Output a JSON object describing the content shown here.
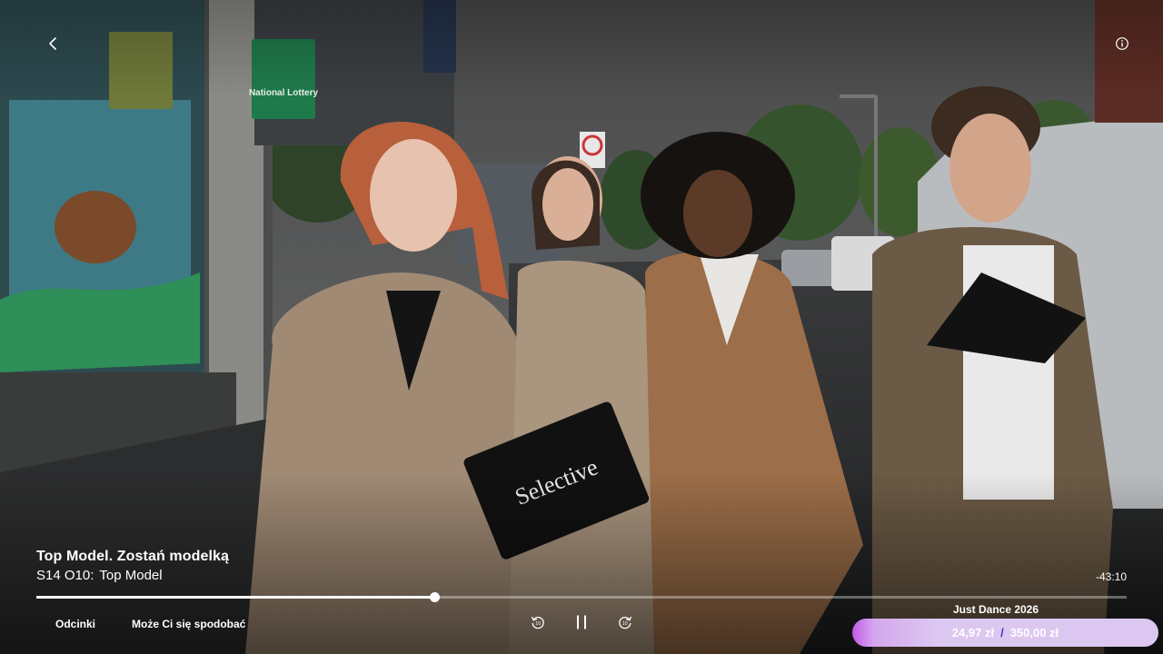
{
  "player": {
    "show_title": "Top Model. Zostań modelką",
    "episode_code": "S14 O10:",
    "episode_title": "Top Model",
    "time_remaining": "-43:10",
    "progress": 0.365,
    "state": "playing"
  },
  "actions": {
    "episodes_label": "Odcinki",
    "recommendations_label": "Może Ci się spodobać"
  },
  "controls": {
    "rewind_icon": "rewind-10-icon",
    "pause_icon": "pause-icon",
    "forward_icon": "forward-10-icon",
    "back_icon": "chevron-left-icon",
    "info_icon": "info-icon"
  },
  "promo": {
    "name": "Just Dance 2026",
    "raised": "24,97 zł",
    "separator": "/",
    "goal": "350,00 zł",
    "fill": 0.07
  },
  "scene": {
    "shop_sign_text": "National Lottery",
    "folder_text": "Selective"
  },
  "colors": {
    "promo_gradient_start": "#c25be6",
    "promo_bar": "#dcc7f0",
    "separator": "#4a2fc9",
    "progress_fill": "#ffffff"
  }
}
